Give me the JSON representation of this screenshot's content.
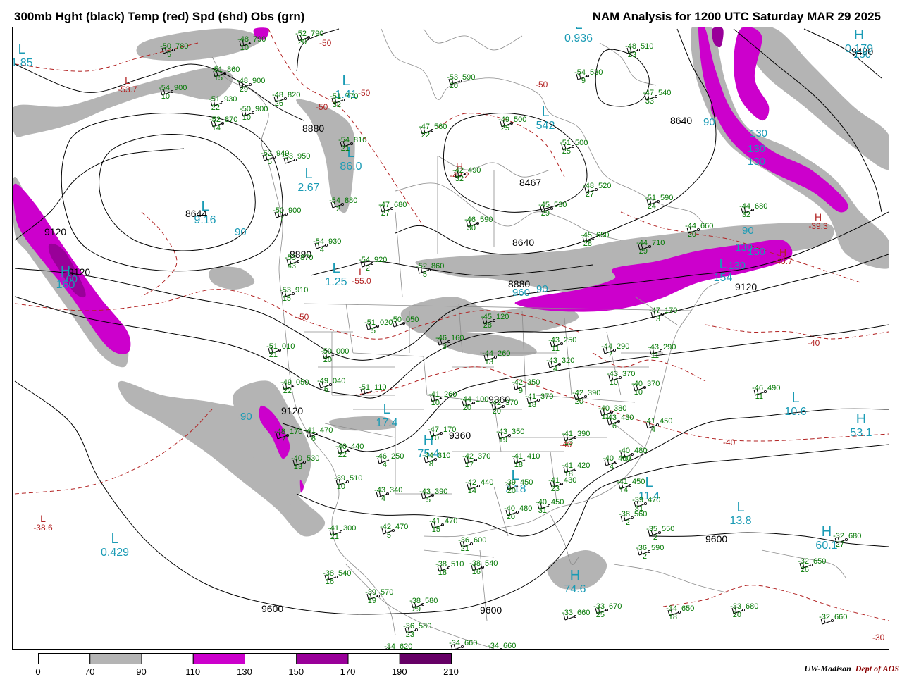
{
  "header": {
    "title_left": "300mb Hght (black) Temp (red) Spd (shd) Obs (grn)",
    "title_right": "NAM Analysis for 1200 UTC Saturday  MAR 29 2025"
  },
  "legend": {
    "labels": [
      "0",
      "70",
      "90",
      "110",
      "130",
      "150",
      "170",
      "190",
      "210"
    ],
    "colors": [
      "#ffffff",
      "#b4b4b4",
      "#ffffff",
      "#cc00cc",
      "#ffffff",
      "#990099",
      "#ffffff",
      "#660066"
    ]
  },
  "credit": {
    "org": "UW-Madison",
    "dept": "Dept of AOS"
  },
  "colors": {
    "height": "#000000",
    "temperature": "#b22222",
    "speed_gray": "#b4b4b4",
    "speed_magenta": "#cc00cc",
    "speed_purple": "#990099",
    "obs": "#007700",
    "centers": "#1a9bb5",
    "borders": "#888888"
  },
  "height_labels": [
    "8880",
    "8644",
    "9120",
    "8880",
    "9120",
    "8467",
    "8640",
    "8640",
    "8880",
    "9120",
    "9360",
    "9360",
    "9120",
    "9480",
    "9600",
    "9600",
    "9600"
  ],
  "centers": [
    {
      "symbol": "L",
      "value": "1.85",
      "color": "cyan"
    },
    {
      "symbol": "L",
      "value": "-53.7",
      "color": "red"
    },
    {
      "symbol": "L",
      "value": "9.16",
      "color": "cyan"
    },
    {
      "symbol": "H",
      "value": "160",
      "color": "cyan"
    },
    {
      "symbol": "L",
      "value": "2.67",
      "color": "cyan"
    },
    {
      "symbol": "L",
      "value": "1.41",
      "color": "cyan"
    },
    {
      "symbol": "L",
      "value": "86.0",
      "color": "cyan"
    },
    {
      "symbol": "L",
      "value": "1.25",
      "color": "cyan"
    },
    {
      "symbol": "L",
      "value": "-55.0",
      "color": "red"
    },
    {
      "symbol": "H",
      "value": "-42.2",
      "color": "red"
    },
    {
      "symbol": "L",
      "value": "542",
      "color": "cyan"
    },
    {
      "symbol": "L",
      "value": "0.936",
      "color": "cyan"
    },
    {
      "symbol": "H",
      "value": "0.179",
      "color": "cyan"
    },
    {
      "symbol": "H",
      "value": "-39.3",
      "color": "red"
    },
    {
      "symbol": "L",
      "value": "154",
      "color": "cyan"
    },
    {
      "symbol": "H",
      "value": "-40.7",
      "color": "red"
    },
    {
      "symbol": "L",
      "value": "17.4",
      "color": "cyan"
    },
    {
      "symbol": "H",
      "value": "75.4",
      "color": "cyan"
    },
    {
      "symbol": "L",
      "value": "7.18",
      "color": "cyan"
    },
    {
      "symbol": "L",
      "value": "11.4",
      "color": "cyan"
    },
    {
      "symbol": "L",
      "value": "13.8",
      "color": "cyan"
    },
    {
      "symbol": "L",
      "value": "10.6",
      "color": "cyan"
    },
    {
      "symbol": "H",
      "value": "53.1",
      "color": "cyan"
    },
    {
      "symbol": "H",
      "value": "60.1",
      "color": "cyan"
    },
    {
      "symbol": "H",
      "value": "74.6",
      "color": "cyan"
    },
    {
      "symbol": "L",
      "value": "-38.6",
      "color": "red"
    },
    {
      "symbol": "L",
      "value": "0.429",
      "color": "cyan"
    }
  ],
  "speed_labels": [
    "90",
    "130",
    "130",
    "130",
    "130",
    "150",
    "130",
    "90",
    "130",
    "90",
    "160",
    "90",
    "960",
    "90"
  ],
  "temp_labels": [
    "-50",
    "-50",
    "-50",
    "-50",
    "-50",
    "-40",
    "-40",
    "-30",
    "-40"
  ],
  "observations": [
    {
      "t": "-48",
      "h": "790",
      "s": "10"
    },
    {
      "t": "-50",
      "h": "780",
      "s": "5"
    },
    {
      "t": "-52",
      "h": "790",
      "s": "20"
    },
    {
      "t": "-51",
      "h": "860",
      "s": "15"
    },
    {
      "t": "-54",
      "h": "900",
      "s": "10"
    },
    {
      "t": "-48",
      "h": "900",
      "s": "29"
    },
    {
      "t": "-51",
      "h": "930",
      "s": "22"
    },
    {
      "t": "-48",
      "h": "820",
      "s": "26"
    },
    {
      "t": "-51",
      "h": "770",
      "s": "32"
    },
    {
      "t": "-50",
      "h": "900",
      "s": "10"
    },
    {
      "t": "-52",
      "h": "870",
      "s": "14"
    },
    {
      "t": "-54",
      "h": "810",
      "s": "21"
    },
    {
      "t": "-52",
      "h": "940",
      "s": "5"
    },
    {
      "t": "-53",
      "h": "950",
      "s": ""
    },
    {
      "t": "-47",
      "h": "560",
      "s": "22"
    },
    {
      "t": "-49",
      "h": "500",
      "s": "25"
    },
    {
      "t": "-53",
      "h": "590",
      "s": "20"
    },
    {
      "t": "-54",
      "h": "530",
      "s": "9"
    },
    {
      "t": "-48",
      "h": "510",
      "s": "23"
    },
    {
      "t": "-47",
      "h": "540",
      "s": "33"
    },
    {
      "t": "-51",
      "h": "500",
      "s": "25"
    },
    {
      "t": "-42",
      "h": "490",
      "s": "32"
    },
    {
      "t": "-47",
      "h": "680",
      "s": "27"
    },
    {
      "t": "-54",
      "h": "880",
      "s": "2"
    },
    {
      "t": "-50",
      "h": "900",
      "s": "7"
    },
    {
      "t": "-45",
      "h": "530",
      "s": "29"
    },
    {
      "t": "-48",
      "h": "520",
      "s": "27"
    },
    {
      "t": "-51",
      "h": "590",
      "s": "24"
    },
    {
      "t": "-44",
      "h": "680",
      "s": "32"
    },
    {
      "t": "-44",
      "h": "660",
      "s": "20"
    },
    {
      "t": "-46",
      "h": "590",
      "s": "30"
    },
    {
      "t": "-45",
      "h": "650",
      "s": "28"
    },
    {
      "t": "-44",
      "h": "710",
      "s": "29"
    },
    {
      "t": "-54",
      "h": "930",
      "s": "4"
    },
    {
      "t": "-53",
      "h": "870",
      "s": "43"
    },
    {
      "t": "-54",
      "h": "920",
      "s": "2"
    },
    {
      "t": "-53",
      "h": "910",
      "s": "15"
    },
    {
      "t": "-52",
      "h": "860",
      "s": "5"
    },
    {
      "t": "-45",
      "h": "120",
      "s": "28"
    },
    {
      "t": "-47",
      "h": "170",
      "s": "3"
    },
    {
      "t": "-46",
      "h": "160",
      "s": "3"
    },
    {
      "t": "-51",
      "h": "020",
      "s": "5"
    },
    {
      "t": "-50",
      "h": "050",
      "s": ""
    },
    {
      "t": "-51",
      "h": "010",
      "s": "21"
    },
    {
      "t": "-50",
      "h": "000",
      "s": "20"
    },
    {
      "t": "-44",
      "h": "260",
      "s": "13"
    },
    {
      "t": "-43",
      "h": "250",
      "s": "11"
    },
    {
      "t": "-44",
      "h": "290",
      "s": "7"
    },
    {
      "t": "-43",
      "h": "290",
      "s": "11"
    },
    {
      "t": "-43",
      "h": "320",
      "s": "4"
    },
    {
      "t": "-49",
      "h": "050",
      "s": "22"
    },
    {
      "t": "-49",
      "h": "040",
      "s": "6"
    },
    {
      "t": "-51",
      "h": "110",
      "s": ""
    },
    {
      "t": "-44",
      "h": "100",
      "s": "20"
    },
    {
      "t": "-41",
      "h": "260",
      "s": "10"
    },
    {
      "t": "-42",
      "h": "350",
      "s": "9"
    },
    {
      "t": "-41",
      "h": "370",
      "s": "18"
    },
    {
      "t": "-42",
      "h": "390",
      "s": "20"
    },
    {
      "t": "-43",
      "h": "370",
      "s": "10"
    },
    {
      "t": "-40",
      "h": "370",
      "s": "10"
    },
    {
      "t": "-40",
      "h": "380",
      "s": "11"
    },
    {
      "t": "-43",
      "h": "430",
      "s": "6"
    },
    {
      "t": "-41",
      "h": "450",
      "s": "4"
    },
    {
      "t": "-41",
      "h": "470",
      "s": "6"
    },
    {
      "t": "-48",
      "h": "170",
      "s": "7"
    },
    {
      "t": "-47",
      "h": "170",
      "s": "10"
    },
    {
      "t": "-43",
      "h": "350",
      "s": "19"
    },
    {
      "t": "-41",
      "h": "390",
      "s": "13"
    },
    {
      "t": "-40",
      "h": "440",
      "s": "22"
    },
    {
      "t": "-46",
      "h": "250",
      "s": "4"
    },
    {
      "t": "-44",
      "h": "310",
      "s": "8"
    },
    {
      "t": "-42",
      "h": "370",
      "s": "17"
    },
    {
      "t": "-41",
      "h": "410",
      "s": "18"
    },
    {
      "t": "-41",
      "h": "420",
      "s": "18"
    },
    {
      "t": "-40",
      "h": "460",
      "s": "4"
    },
    {
      "t": "-40",
      "h": "480",
      "s": "10"
    },
    {
      "t": "-39",
      "h": "510",
      "s": "10"
    },
    {
      "t": "-43",
      "h": "340",
      "s": "4"
    },
    {
      "t": "-43",
      "h": "390",
      "s": "5"
    },
    {
      "t": "-42",
      "h": "440",
      "s": "14"
    },
    {
      "t": "-39",
      "h": "450",
      "s": "20"
    },
    {
      "t": "-41",
      "h": "430",
      "s": "23"
    },
    {
      "t": "-41",
      "h": "450",
      "s": "14"
    },
    {
      "t": "-40",
      "h": "530",
      "s": "13"
    },
    {
      "t": "-41",
      "h": "300",
      "s": "21"
    },
    {
      "t": "-42",
      "h": "470",
      "s": "5"
    },
    {
      "t": "-41",
      "h": "470",
      "s": "15"
    },
    {
      "t": "-40",
      "h": "480",
      "s": "20"
    },
    {
      "t": "-40",
      "h": "450",
      "s": "31"
    },
    {
      "t": "-39",
      "h": "470",
      "s": "31"
    },
    {
      "t": "-38",
      "h": "560",
      "s": "2"
    },
    {
      "t": "-35",
      "h": "550",
      "s": "2"
    },
    {
      "t": "-36",
      "h": "590",
      "s": "2"
    },
    {
      "t": "-36",
      "h": "600",
      "s": "21"
    },
    {
      "t": "-38",
      "h": "510",
      "s": "18"
    },
    {
      "t": "-38",
      "h": "540",
      "s": "16"
    },
    {
      "t": "-38",
      "h": "540",
      "s": "16"
    },
    {
      "t": "-39",
      "h": "570",
      "s": "19"
    },
    {
      "t": "-38",
      "h": "580",
      "s": "29"
    },
    {
      "t": "-36",
      "h": "580",
      "s": "23"
    },
    {
      "t": "-34",
      "h": "620",
      "s": "14"
    },
    {
      "t": "-34",
      "h": "660",
      "s": ""
    },
    {
      "t": "-34",
      "h": "660",
      "s": ""
    },
    {
      "t": "-33",
      "h": "660",
      "s": ""
    },
    {
      "t": "-33",
      "h": "670",
      "s": "25"
    },
    {
      "t": "-34",
      "h": "650",
      "s": "18"
    },
    {
      "t": "-33",
      "h": "680",
      "s": "20"
    },
    {
      "t": "-32",
      "h": "680",
      "s": "27"
    },
    {
      "t": "-32",
      "h": "650",
      "s": "26"
    },
    {
      "t": "-32",
      "h": "660",
      "s": ""
    },
    {
      "t": "-46",
      "h": "490",
      "s": "11"
    },
    {
      "t": "-42",
      "h": "370",
      "s": "20"
    }
  ]
}
